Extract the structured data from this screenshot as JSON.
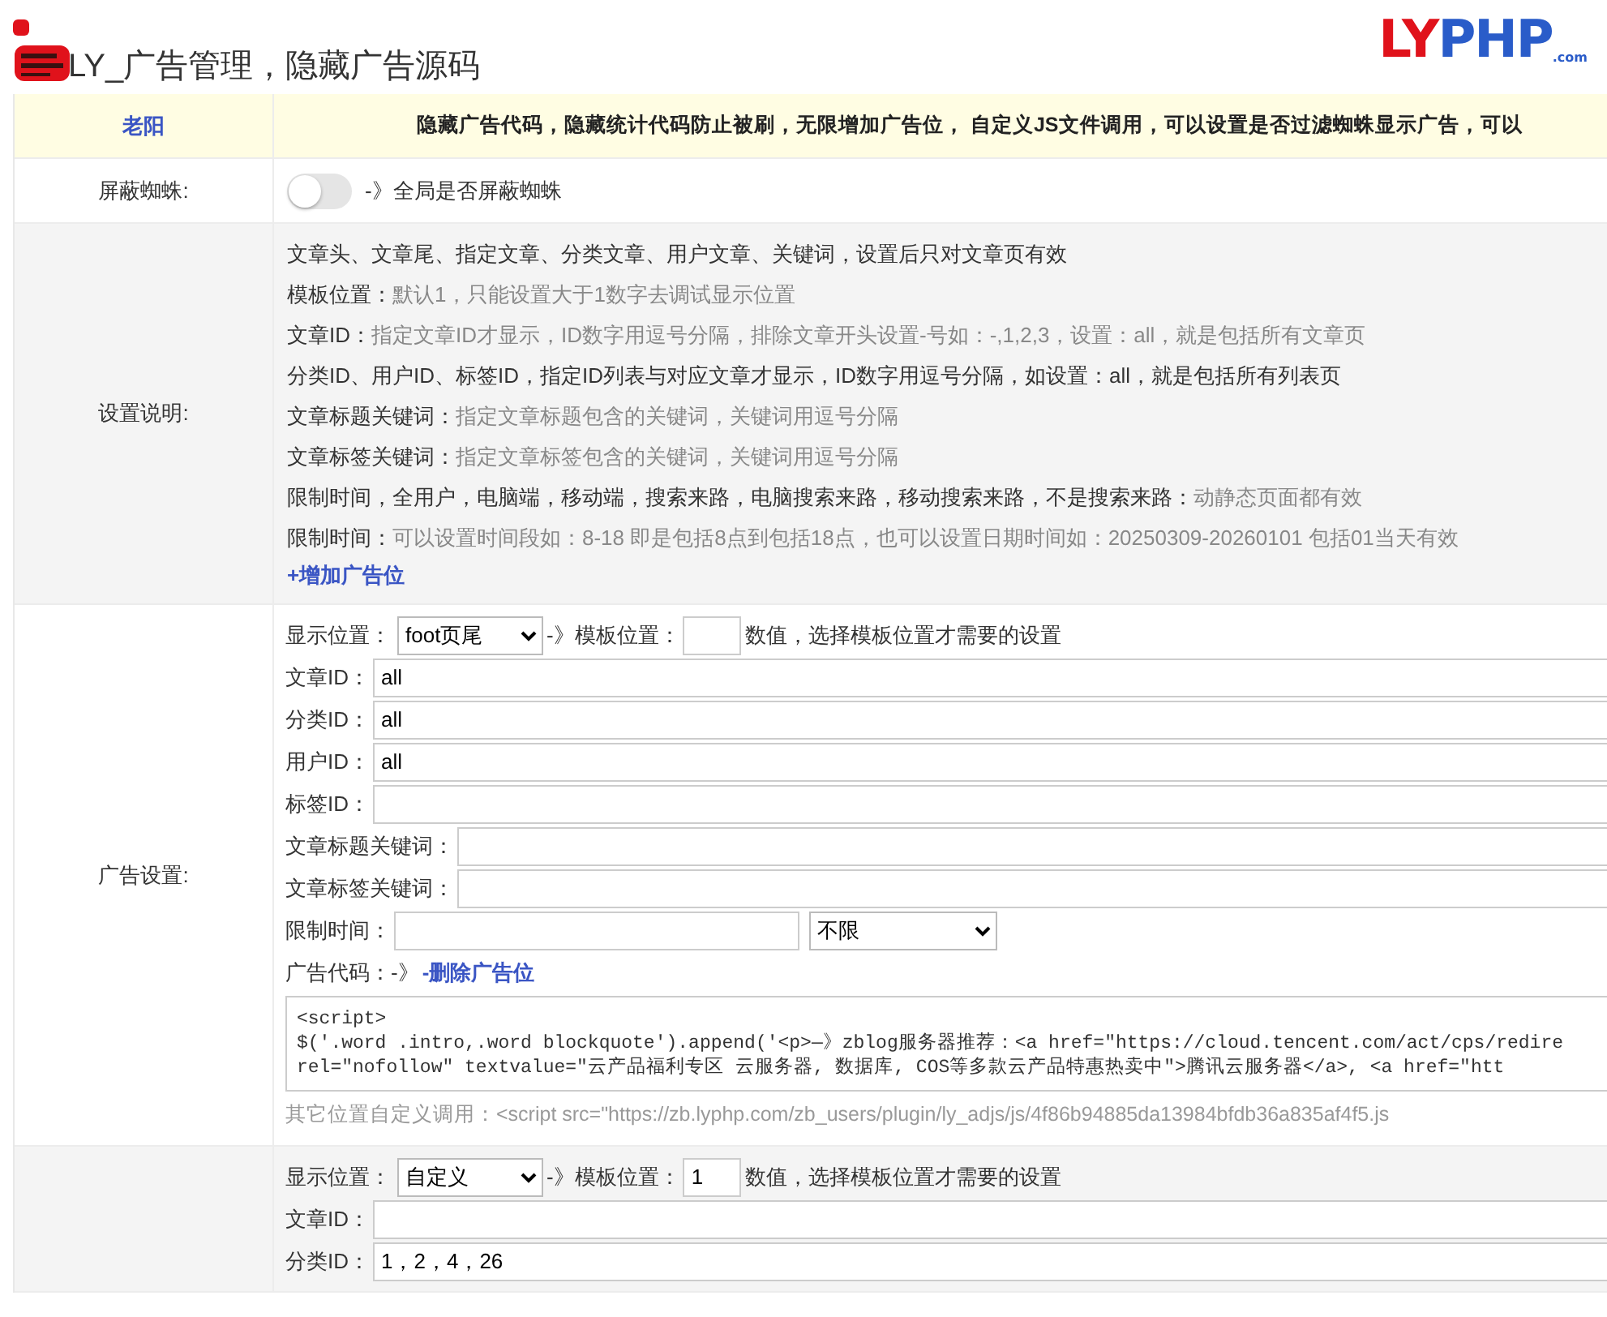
{
  "page": {
    "title": "LY_广告管理，隐藏广告源码",
    "logo": {
      "main": "LY",
      "accent": "PHP",
      "suffix": ".com"
    }
  },
  "header": {
    "author": "老阳",
    "summary": "隐藏广告代码，隐藏统计代码防止被刷，无限增加广告位， 自定义JS文件调用，可以设置是否过滤蜘蛛显示广告，可以"
  },
  "spider": {
    "label": "屏蔽蜘蛛:",
    "on": false,
    "hint": "-》全局是否屏蔽蜘蛛"
  },
  "notes": {
    "label": "设置说明:",
    "lines": [
      {
        "strong": "文章头、文章尾、指定文章、分类文章、用户文章、关键词，设置后只对文章页有效"
      },
      {
        "strong": "模板位置：",
        "muted": "默认1，只能设置大于1数字去调试显示位置"
      },
      {
        "strong": "文章ID：",
        "muted": "指定文章ID才显示，ID数字用逗号分隔，排除文章开头设置-号如：-,1,2,3，设置：all，就是包括所有文章页"
      },
      {
        "strong": "分类ID、用户ID、标签ID，指定ID列表与对应文章才显示，ID数字用逗号分隔，如设置：all，就是包括所有列表页"
      },
      {
        "strong": "文章标题关键词：",
        "muted": "指定文章标题包含的关键词，关键词用逗号分隔"
      },
      {
        "strong": "文章标签关键词：",
        "muted": "指定文章标签包含的关键词，关键词用逗号分隔"
      },
      {
        "strong": "限制时间，全用户，电脑端，移动端，搜索来路，电脑搜索来路，移动搜索来路，不是搜索来路：",
        "muted": "动静态页面都有效"
      },
      {
        "strong": "限制时间：",
        "muted": "可以设置时间段如：8-18 即是包括8点到包括18点，也可以设置日期时间如：20250309-20260101 包括01当天有效"
      }
    ],
    "add_link": "+增加广告位"
  },
  "ad_blocks": [
    {
      "label": "广告设置:",
      "position_label": "显示位置：",
      "position": "foot页尾",
      "arrow": "-》模板位置：",
      "hint": "数值，选择模板位置才需要的设置",
      "fields": [
        {
          "label": "文章ID：",
          "value": "all"
        },
        {
          "label": "分类ID：",
          "value": "all"
        },
        {
          "label": "用户ID：",
          "value": "all"
        },
        {
          "label": "标签ID："
        },
        {
          "label": "文章标题关键词："
        },
        {
          "label": "文章标签关键词："
        }
      ],
      "time": {
        "label": "限制时间：",
        "select": "不限"
      },
      "code_label": "广告代码：-》",
      "delete_link": "-删除广告位",
      "code_lines": [
        "<script>",
        "$('.word .intro,.word blockquote').append('<p>—》zblog服务器推荐：<a href=\"https://cloud.tencent.com/act/cps/redire",
        "rel=\"nofollow\" textvalue=\"云产品福利专区 云服务器, 数据库, COS等多款云产品特惠热卖中\">腾讯云服务器</a>, <a href=\"htt"
      ],
      "embed": "其它位置自定义调用：<script src=\"https://zb.lyphp.com/zb_users/plugin/ly_adjs/js/4f86b94885da13984bfdb36a835af4f5.js"
    },
    {
      "position_label": "显示位置：",
      "position": "自定义",
      "arrow": "-》模板位置：",
      "template": "1",
      "hint": "数值，选择模板位置才需要的设置",
      "fields": [
        {
          "label": "文章ID："
        },
        {
          "label": "分类ID：",
          "value": "1，2，4，26"
        }
      ]
    }
  ]
}
